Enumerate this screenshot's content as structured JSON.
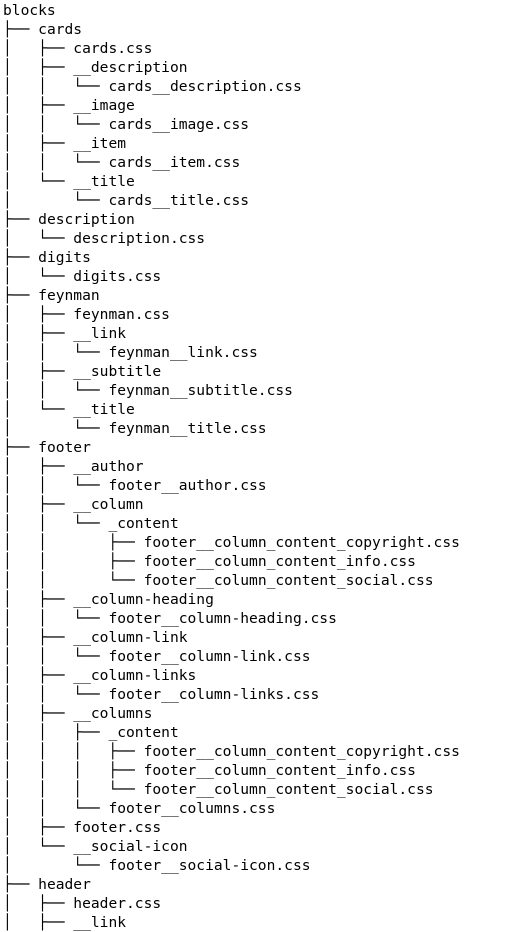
{
  "window": {
    "background": "#ffffff",
    "text_color": "#000000"
  },
  "tree": {
    "lines": [
      {
        "prefix": "",
        "name": "blocks"
      },
      {
        "prefix": "├── ",
        "name": "cards"
      },
      {
        "prefix": "│   ├── ",
        "name": "cards.css"
      },
      {
        "prefix": "│   ├── ",
        "name": "__description"
      },
      {
        "prefix": "│   │   └── ",
        "name": "cards__description.css"
      },
      {
        "prefix": "│   ├── ",
        "name": "__image"
      },
      {
        "prefix": "│   │   └── ",
        "name": "cards__image.css"
      },
      {
        "prefix": "│   ├── ",
        "name": "__item"
      },
      {
        "prefix": "│   │   └── ",
        "name": "cards__item.css"
      },
      {
        "prefix": "│   └── ",
        "name": "__title"
      },
      {
        "prefix": "│       └── ",
        "name": "cards__title.css"
      },
      {
        "prefix": "├── ",
        "name": "description"
      },
      {
        "prefix": "│   └── ",
        "name": "description.css"
      },
      {
        "prefix": "├── ",
        "name": "digits"
      },
      {
        "prefix": "│   └── ",
        "name": "digits.css"
      },
      {
        "prefix": "├── ",
        "name": "feynman"
      },
      {
        "prefix": "│   ├── ",
        "name": "feynman.css"
      },
      {
        "prefix": "│   ├── ",
        "name": "__link"
      },
      {
        "prefix": "│   │   └── ",
        "name": "feynman__link.css"
      },
      {
        "prefix": "│   ├── ",
        "name": "__subtitle"
      },
      {
        "prefix": "│   │   └── ",
        "name": "feynman__subtitle.css"
      },
      {
        "prefix": "│   └── ",
        "name": "__title"
      },
      {
        "prefix": "│       └── ",
        "name": "feynman__title.css"
      },
      {
        "prefix": "├── ",
        "name": "footer"
      },
      {
        "prefix": "│   ├── ",
        "name": "__author"
      },
      {
        "prefix": "│   │   └── ",
        "name": "footer__author.css"
      },
      {
        "prefix": "│   ├── ",
        "name": "__column"
      },
      {
        "prefix": "│   │   └── ",
        "name": "_content"
      },
      {
        "prefix": "│   │       ├── ",
        "name": "footer__column_content_copyright.css"
      },
      {
        "prefix": "│   │       ├── ",
        "name": "footer__column_content_info.css"
      },
      {
        "prefix": "│   │       └── ",
        "name": "footer__column_content_social.css"
      },
      {
        "prefix": "│   ├── ",
        "name": "__column-heading"
      },
      {
        "prefix": "│   │   └── ",
        "name": "footer__column-heading.css"
      },
      {
        "prefix": "│   ├── ",
        "name": "__column-link"
      },
      {
        "prefix": "│   │   └── ",
        "name": "footer__column-link.css"
      },
      {
        "prefix": "│   ├── ",
        "name": "__column-links"
      },
      {
        "prefix": "│   │   └── ",
        "name": "footer__column-links.css"
      },
      {
        "prefix": "│   ├── ",
        "name": "__columns"
      },
      {
        "prefix": "│   │   ├── ",
        "name": "_content"
      },
      {
        "prefix": "│   │   │   ├── ",
        "name": "footer__column_content_copyright.css"
      },
      {
        "prefix": "│   │   │   ├── ",
        "name": "footer__column_content_info.css"
      },
      {
        "prefix": "│   │   │   └── ",
        "name": "footer__column_content_social.css"
      },
      {
        "prefix": "│   │   └── ",
        "name": "footer__columns.css"
      },
      {
        "prefix": "│   ├── ",
        "name": "footer.css"
      },
      {
        "prefix": "│   └── ",
        "name": "__social-icon"
      },
      {
        "prefix": "│       └── ",
        "name": "footer__social-icon.css"
      },
      {
        "prefix": "├── ",
        "name": "header"
      },
      {
        "prefix": "│   ├── ",
        "name": "header.css"
      },
      {
        "prefix": "│   ├── ",
        "name": "__link"
      }
    ]
  }
}
